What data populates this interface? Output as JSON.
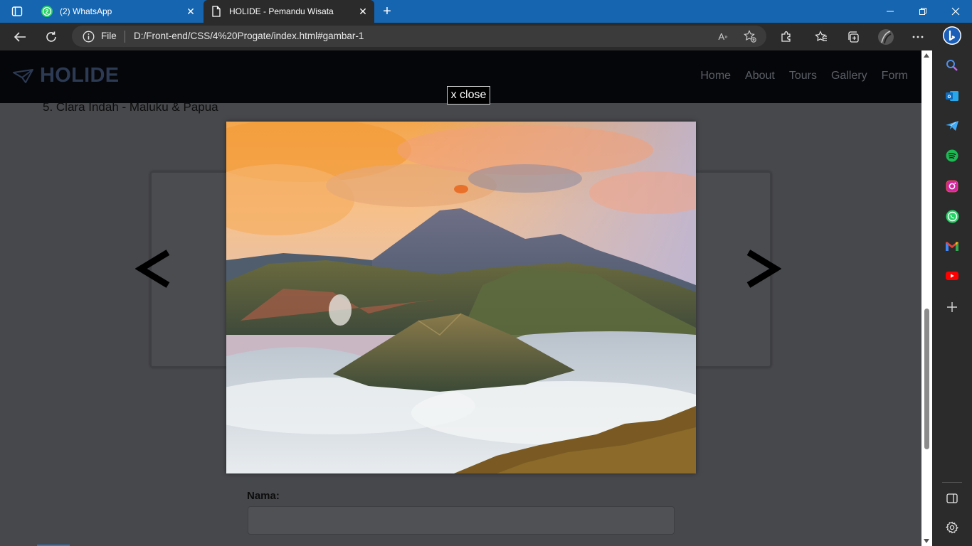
{
  "browser": {
    "tabs": [
      {
        "title": "(2) WhatsApp",
        "badge": "2",
        "active": false
      },
      {
        "title": "HOLIDE - Pemandu Wisata",
        "active": true
      }
    ],
    "address": {
      "scheme_label": "File",
      "url": "D:/Front-end/CSS/4%20Progate/index.html#gambar-1"
    },
    "window_controls": [
      "minimize-icon",
      "restore-icon",
      "close-icon"
    ],
    "toolbar_icons": [
      "back-icon",
      "refresh-icon",
      "read-aloud-icon",
      "favorite-add-icon",
      "extensions-icon",
      "favorites-icon",
      "collections-icon",
      "profile-avatar",
      "more-icon"
    ],
    "sidebar_icons": [
      "bing-copilot-icon",
      "search-icon",
      "outlook-icon",
      "telegram-icon",
      "spotify-icon",
      "instagram-icon",
      "whatsapp-icon",
      "gmail-icon",
      "youtube-icon",
      "add-icon",
      "split-view-icon",
      "settings-icon"
    ]
  },
  "page": {
    "brand": "HOLIDE",
    "nav": [
      "Home",
      "About",
      "Tours",
      "Gallery",
      "Form"
    ],
    "list_item": "5. Clara Indah - Maluku & Papua",
    "lightbox": {
      "close_label": "x close",
      "image_subject": "Mount Bromo volcano at sunrise above a sea of clouds"
    },
    "arrows": {
      "prev": "<",
      "next": ">"
    },
    "form": {
      "name_label": "Nama:",
      "name_value": ""
    }
  },
  "colors": {
    "tabstrip": "#1565b0",
    "chrome": "#2b2b2b",
    "navbar": "#05060a",
    "overlay": "#47484c",
    "brand": "#2d3a54"
  }
}
